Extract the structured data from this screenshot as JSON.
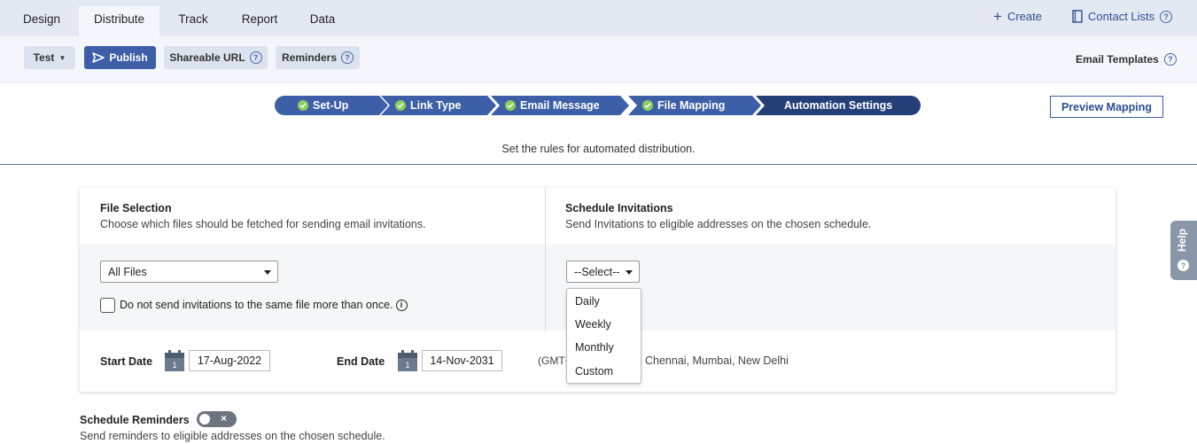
{
  "tabs": [
    "Design",
    "Distribute",
    "Track",
    "Report",
    "Data"
  ],
  "top_right": {
    "create": "Create",
    "contact_lists": "Contact Lists"
  },
  "toolbar": {
    "test": "Test",
    "publish": "Publish",
    "shareable_url": "Shareable URL",
    "reminders": "Reminders",
    "email_templates": "Email Templates"
  },
  "steps": [
    "Set-Up",
    "Link Type",
    "Email Message",
    "File Mapping",
    "Automation Settings"
  ],
  "preview_mapping": "Preview Mapping",
  "subtitle": "Set the rules for automated distribution.",
  "file_selection": {
    "title": "File Selection",
    "desc": "Choose which files should be fetched for sending email invitations.",
    "select_value": "All Files",
    "checkbox_label": "Do not send invitations to the same file more than once."
  },
  "schedule": {
    "title": "Schedule Invitations",
    "desc": "Send Invitations to eligible addresses on the chosen schedule.",
    "select_value": "--Select--",
    "options": [
      "Daily",
      "Weekly",
      "Monthly",
      "Custom"
    ]
  },
  "dates": {
    "start_label": "Start Date",
    "start_value": "17-Aug-2022",
    "end_label": "End Date",
    "end_value": "14-Nov-2031",
    "calendar_day": "1",
    "timezone_prefix": "(GMT+",
    "timezone_suffix": "Chennai, Mumbai, New Delhi"
  },
  "schedule_reminders": {
    "title": "Schedule Reminders",
    "desc": "Send reminders to eligible addresses on the chosen schedule."
  },
  "help": "Help",
  "colors": {
    "primary": "#3c5fa8",
    "step_done": "#3c5fa8",
    "step_active": "#243f78",
    "check": "#8ccf5d"
  }
}
